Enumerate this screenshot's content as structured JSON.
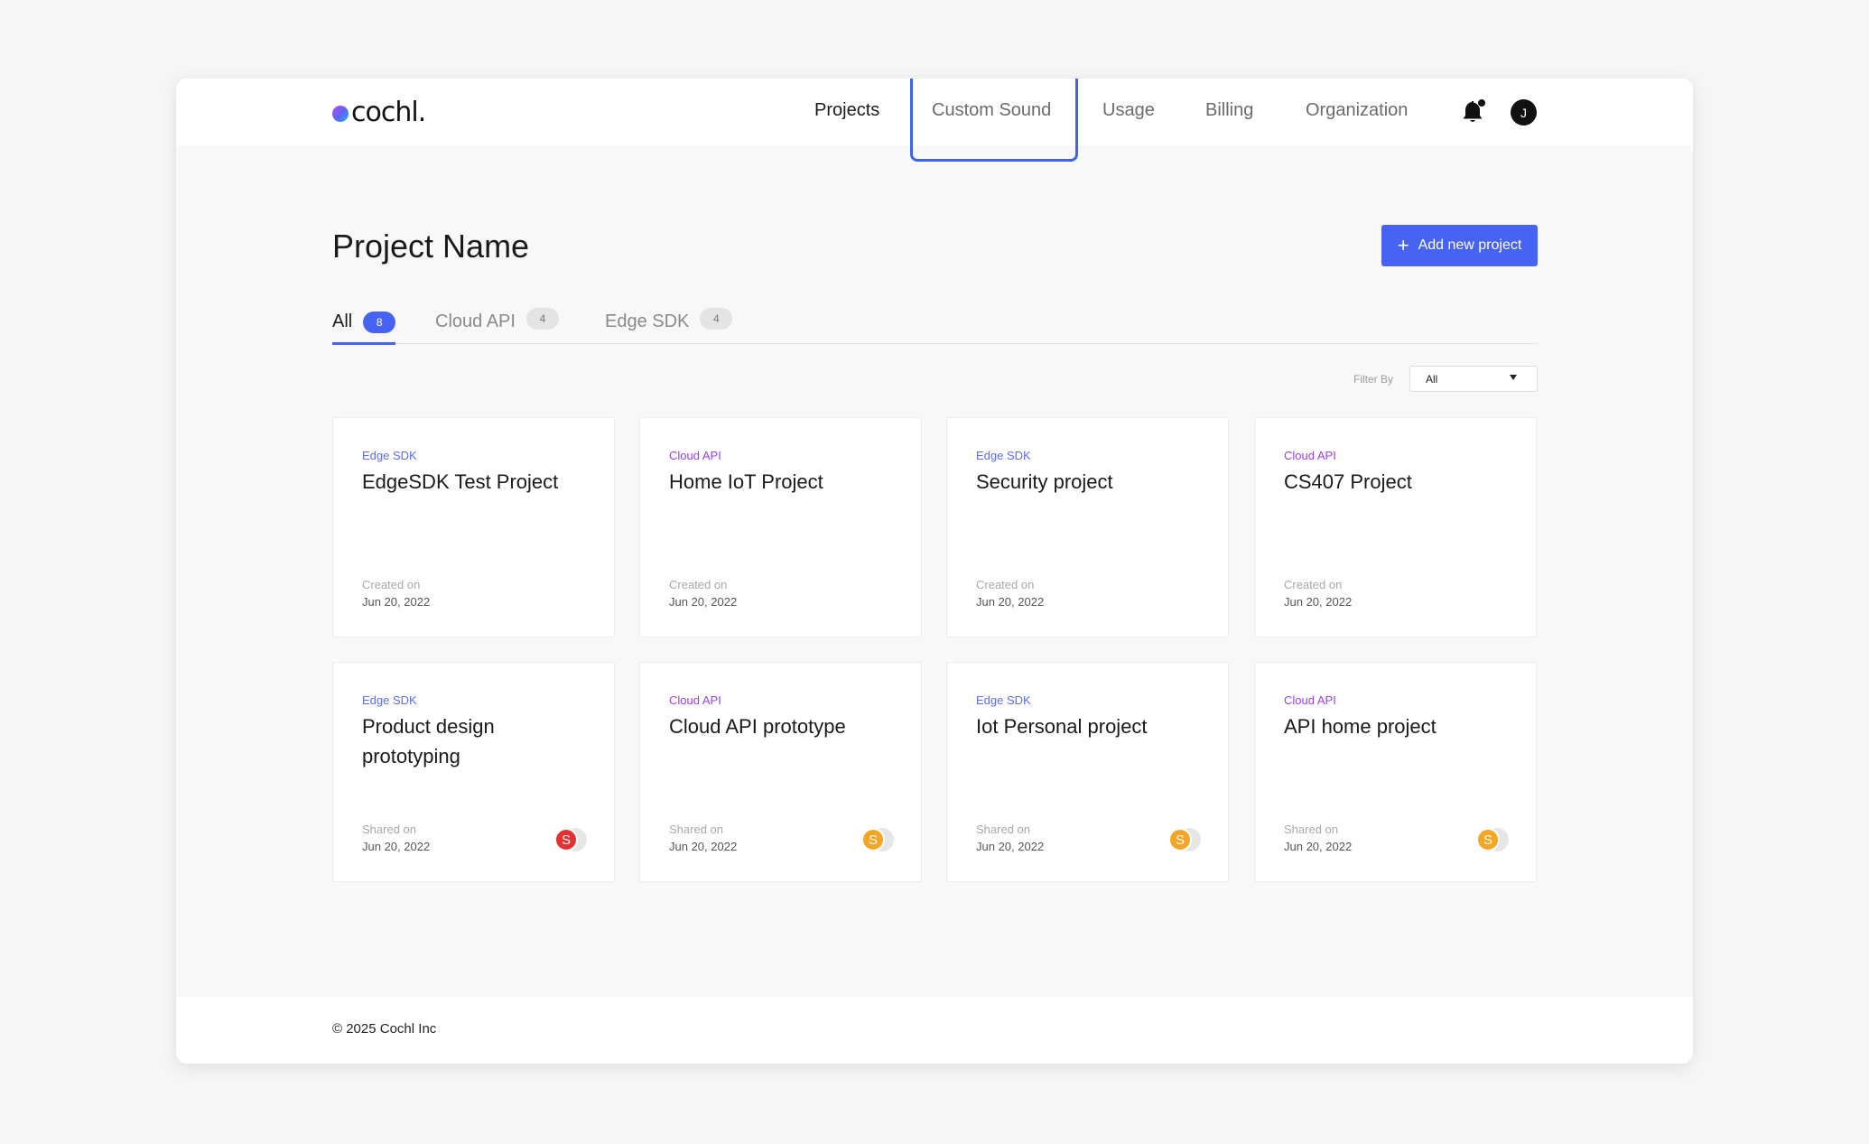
{
  "logo": {
    "text": "cochl."
  },
  "nav": [
    {
      "label": "Projects",
      "active": true
    },
    {
      "label": "Custom Sound",
      "active": false
    },
    {
      "label": "Usage",
      "active": false
    },
    {
      "label": "Billing",
      "active": false
    },
    {
      "label": "Organization",
      "active": false
    }
  ],
  "user": {
    "initial": "J",
    "icons": [
      "bell-icon"
    ]
  },
  "page": {
    "title": "Project Name",
    "add_button": "Add new project"
  },
  "tabs": [
    {
      "label": "All",
      "count": "8",
      "active": true
    },
    {
      "label": "Cloud API",
      "count": "4",
      "active": false
    },
    {
      "label": "Edge SDK",
      "count": "4",
      "active": false
    }
  ],
  "filter": {
    "label": "Filter By",
    "value": "All"
  },
  "cards": [
    {
      "kind": "Edge SDK",
      "name": "EdgeSDK Test Project",
      "meta_label": "Created on",
      "date": "Jun 20, 2022"
    },
    {
      "kind": "Cloud API",
      "name": "Home IoT Project",
      "meta_label": "Created on",
      "date": "Jun 20, 2022"
    },
    {
      "kind": "Edge SDK",
      "name": "Security project",
      "meta_label": "Created on",
      "date": "Jun 20, 2022"
    },
    {
      "kind": "Cloud API",
      "name": "CS407 Project",
      "meta_label": "Created on",
      "date": "Jun 20, 2022"
    },
    {
      "kind": "Edge SDK",
      "name": "Product design prototyping",
      "meta_label": "Shared on",
      "date": "Jun 20, 2022",
      "sharer": "S",
      "sharer_color": "#e53131"
    },
    {
      "kind": "Cloud API",
      "name": "Cloud API prototype",
      "meta_label": "Shared on",
      "date": "Jun 20, 2022",
      "sharer": "S",
      "sharer_color": "#f5a524"
    },
    {
      "kind": "Edge SDK",
      "name": "Iot Personal project",
      "meta_label": "Shared on",
      "date": "Jun 20, 2022",
      "sharer": "S",
      "sharer_color": "#f5a524"
    },
    {
      "kind": "Cloud API",
      "name": "API home project",
      "meta_label": "Shared on",
      "date": "Jun 20, 2022",
      "sharer": "S",
      "sharer_color": "#f5a524"
    }
  ],
  "footer": {
    "copyright": "© 2025 Cochl Inc"
  },
  "colors": {
    "accent": "#4763f4",
    "edge": "#5b6cf0",
    "cloud": "#9a3ff0",
    "highlight": "#3c63f0"
  }
}
